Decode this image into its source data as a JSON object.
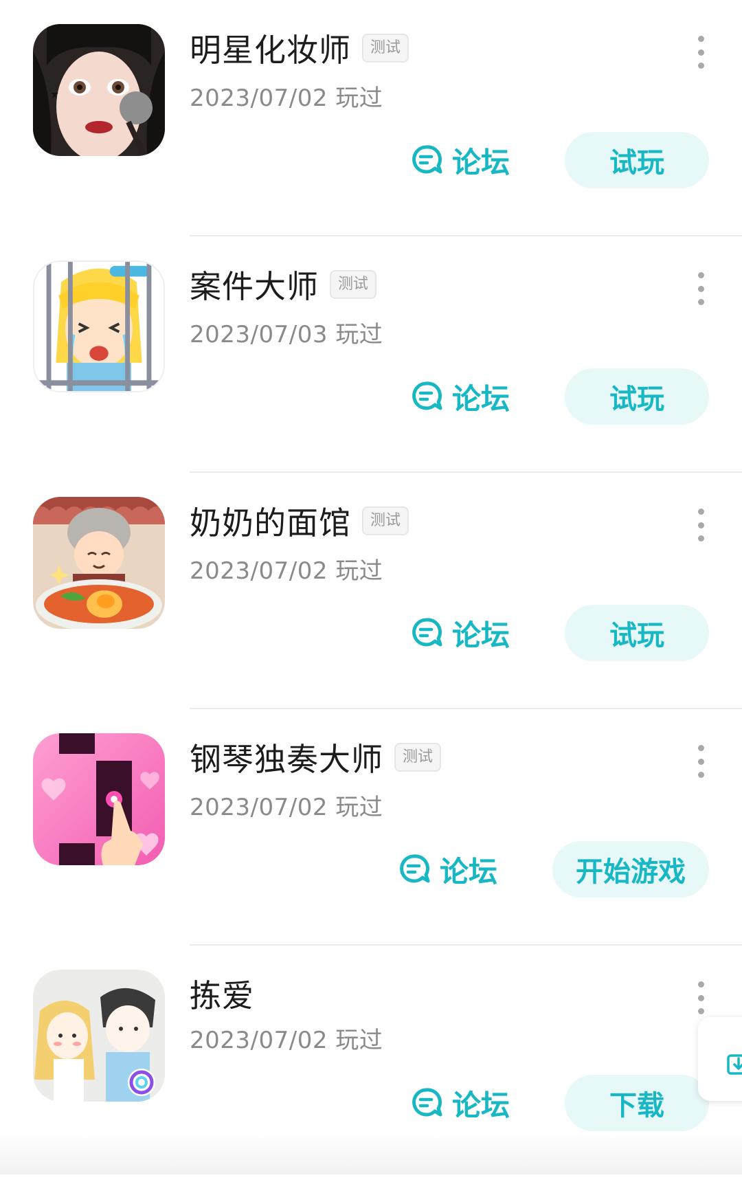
{
  "games": [
    {
      "title": "明星化妆师",
      "badge": "测试",
      "played": "2023/07/02 玩过",
      "forum_label": "论坛",
      "action_label": "试玩",
      "icon": "makeup-girl-icon"
    },
    {
      "title": "案件大师",
      "badge": "测试",
      "played": "2023/07/03 玩过",
      "forum_label": "论坛",
      "action_label": "试玩",
      "icon": "crying-girl-jail-icon"
    },
    {
      "title": "奶奶的面馆",
      "badge": "测试",
      "played": "2023/07/02 玩过",
      "forum_label": "论坛",
      "action_label": "试玩",
      "icon": "grandma-noodles-icon"
    },
    {
      "title": "钢琴独奏大师",
      "badge": "测试",
      "played": "2023/07/02 玩过",
      "forum_label": "论坛",
      "action_label": "开始游戏",
      "icon": "pink-piano-tiles-icon"
    },
    {
      "title": "拣爱",
      "played": "2023/07/02 玩过",
      "forum_label": "论坛",
      "action_label": "下载",
      "icon": "sketch-couple-icon"
    }
  ],
  "colors": {
    "accent": "#17b7c4",
    "button_bg": "#e7f8f9",
    "title": "#1c1c1c",
    "subtext": "#8a8a8a"
  }
}
